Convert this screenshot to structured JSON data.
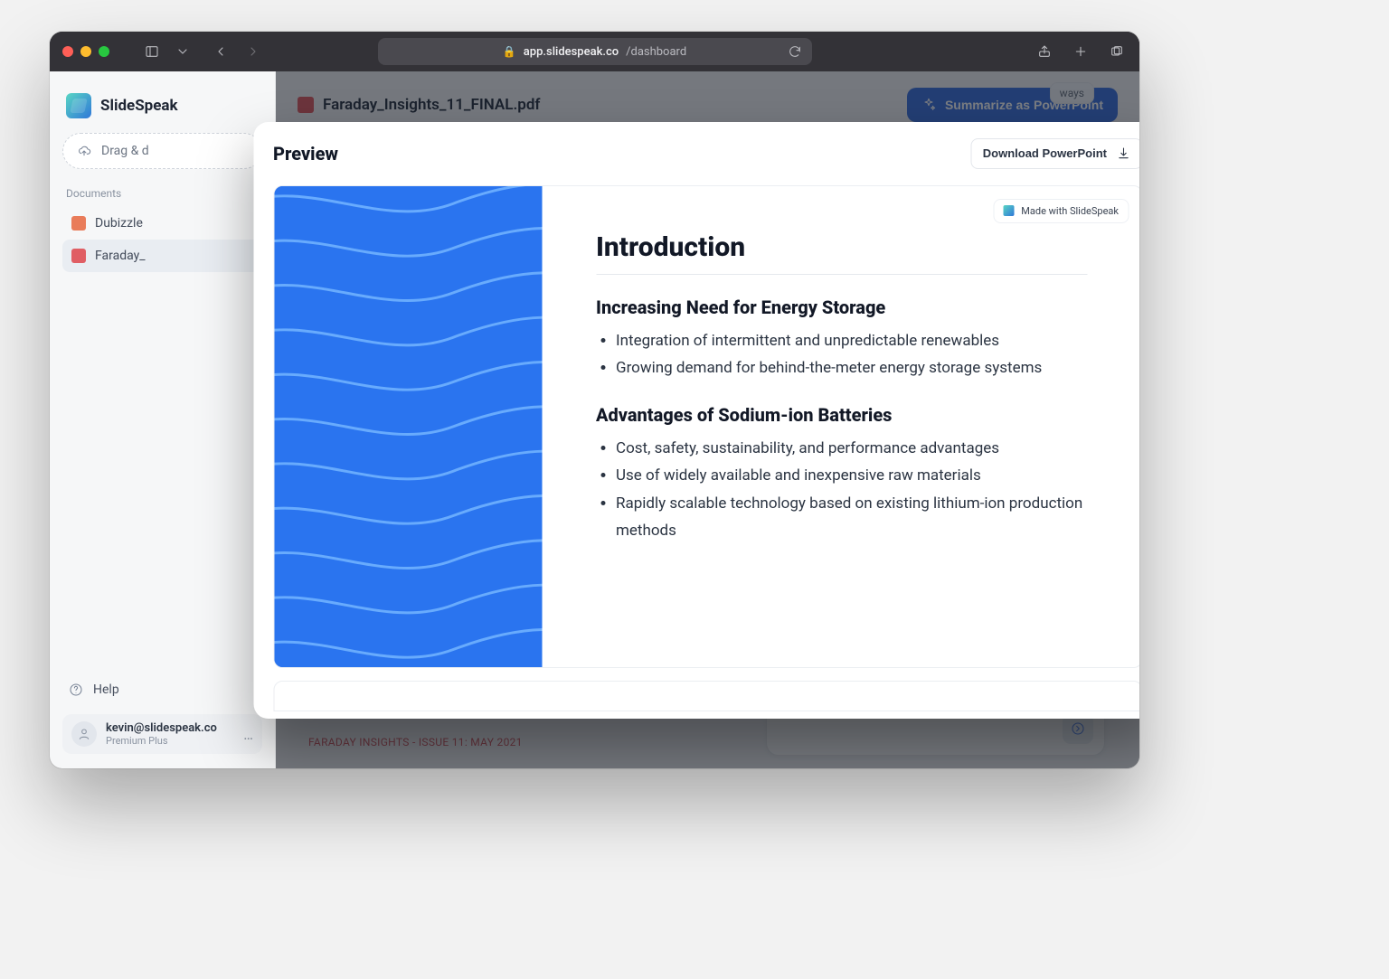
{
  "browser": {
    "url_host": "app.slidespeak.co",
    "url_path": "/dashboard"
  },
  "app": {
    "name": "SlideSpeak"
  },
  "sidebar": {
    "upload_label": "Drag & d",
    "documents_label": "Documents",
    "items": [
      {
        "label": "Dubizzle"
      },
      {
        "label": "Faraday_"
      }
    ],
    "help_label": "Help",
    "account": {
      "email": "kevin@slidespeak.co",
      "plan": "Premium Plus",
      "more": "…"
    }
  },
  "main": {
    "current_file": "Faraday_Insights_11_FINAL.pdf",
    "summarize_btn": "Summarize as PowerPoint",
    "footnote": "FARADAY INSIGHTS - ISSUE 11: MAY 2021",
    "chip": "ways"
  },
  "modal": {
    "title": "Preview",
    "download_btn": "Download PowerPoint",
    "made_with": "Made with SlideSpeak",
    "slide": {
      "title": "Introduction",
      "sections": [
        {
          "heading": "Increasing Need for Energy Storage",
          "bullets": [
            "Integration of intermittent and unpredictable renewables",
            "Growing demand for behind-the-meter energy storage systems"
          ]
        },
        {
          "heading": "Advantages of Sodium-ion Batteries",
          "bullets": [
            "Cost, safety, sustainability, and performance advantages",
            "Use of widely available and inexpensive raw materials",
            "Rapidly scalable technology based on existing lithium-ion production methods"
          ]
        }
      ]
    }
  }
}
